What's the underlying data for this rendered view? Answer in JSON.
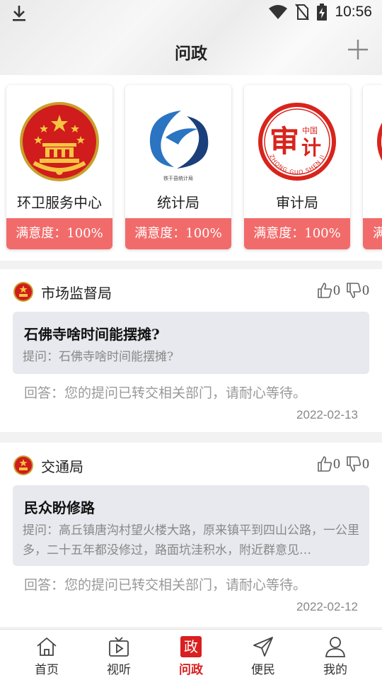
{
  "status_bar": {
    "time": "10:56"
  },
  "header": {
    "title": "问政"
  },
  "departments": [
    {
      "name": "环卫服务中心",
      "satisfaction": "满意度：100%",
      "logo": "national-emblem"
    },
    {
      "name": "统计局",
      "satisfaction": "满意度：100%",
      "logo": "statistics-bureau-logo",
      "logo_caption": "铁干县统计局"
    },
    {
      "name": "审计局",
      "satisfaction": "满意度：100%",
      "logo": "audit-bureau-logo",
      "logo_char": "审",
      "logo_small": "中国",
      "logo_char2": "计",
      "logo_ring": "ZHONG GUO SHEN JI"
    },
    {
      "name": "",
      "satisfaction": "满",
      "logo": "audit-bureau-logo"
    }
  ],
  "questions": [
    {
      "department": "市场监督局",
      "likes": "0",
      "dislikes": "0",
      "title": "石佛寺啥时间能摆摊?",
      "body": "提问：石佛寺啥时间能摆摊?",
      "answer": "回答：您的提问已转交相关部门，请耐心等待。",
      "date": "2022-02-13"
    },
    {
      "department": "交通局",
      "likes": "0",
      "dislikes": "0",
      "title": "民众盼修路",
      "body": "提问：高丘镇唐沟村望火楼大路，原来镇平到四山公路，一公里多，二十五年都没修过，路面坑洼积水，附近群意见…",
      "answer": "回答：您的提问已转交相关部门，请耐心等待。",
      "date": "2022-02-12"
    }
  ],
  "tabs": [
    {
      "label": "首页",
      "icon": "home-icon"
    },
    {
      "label": "视听",
      "icon": "tv-icon"
    },
    {
      "label": "问政",
      "icon": "zheng-icon",
      "glyph": "政",
      "active": true
    },
    {
      "label": "便民",
      "icon": "send-icon"
    },
    {
      "label": "我的",
      "icon": "user-icon"
    }
  ],
  "colors": {
    "accent": "#d91f1f",
    "satisfaction_bg": "#f26b6b",
    "question_bg": "#e7e9ee"
  }
}
